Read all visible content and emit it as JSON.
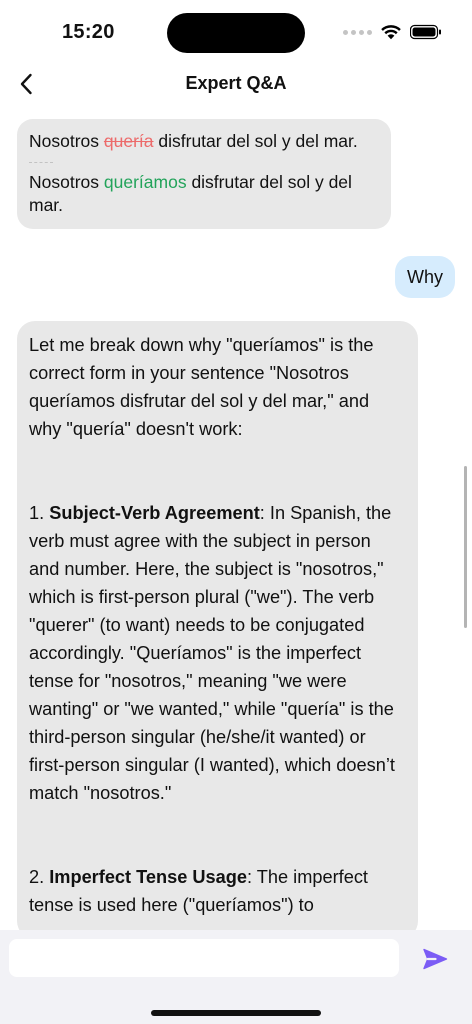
{
  "status_bar": {
    "time": "15:20"
  },
  "nav": {
    "title": "Expert Q&A"
  },
  "correction": {
    "original_prefix": "Nosotros ",
    "original_wrong": "quería",
    "original_suffix": " disfrutar del sol y del mar.",
    "divider": "---",
    "corrected_prefix": "Nosotros ",
    "corrected_right": "queríamos",
    "corrected_suffix": " disfrutar del sol y del mar."
  },
  "user_message": "Why",
  "answer": {
    "intro": "Let me break down why \"queríamos\" is the correct form in your sentence \"Nosotros queríamos disfrutar del sol y del mar,\" and why \"quería\" doesn't work:",
    "point1_prefix": "1. ",
    "point1_title": "Subject-Verb Agreement",
    "point1_body": ": In Spanish, the verb must agree with the subject in person and number. Here, the subject is \"nosotros,\" which is first-person plural (\"we\"). The verb \"querer\" (to want) needs to be conjugated accordingly. \"Queríamos\" is the imperfect tense for \"nosotros,\" meaning \"we were wanting\" or \"we wanted,\" while \"quería\" is the third-person singular (he/she/it wanted) or first-person singular (I wanted), which doesn’t match \"nosotros.\"",
    "point2_prefix": "2. ",
    "point2_title": "Imperfect Tense Usage",
    "point2_body": ": The imperfect tense is used here (\"queríamos\") to"
  },
  "input": {
    "value": "",
    "placeholder": ""
  },
  "icons": {
    "back": "chevron-left-icon",
    "send": "send-icon",
    "wifi": "wifi-icon",
    "battery": "battery-icon"
  },
  "colors": {
    "wrong": "#ec6b6b",
    "right": "#22a35a",
    "user_bubble": "#d6ecfd",
    "bot_bubble": "#e8e8e8",
    "send": "#7b5cf5"
  }
}
